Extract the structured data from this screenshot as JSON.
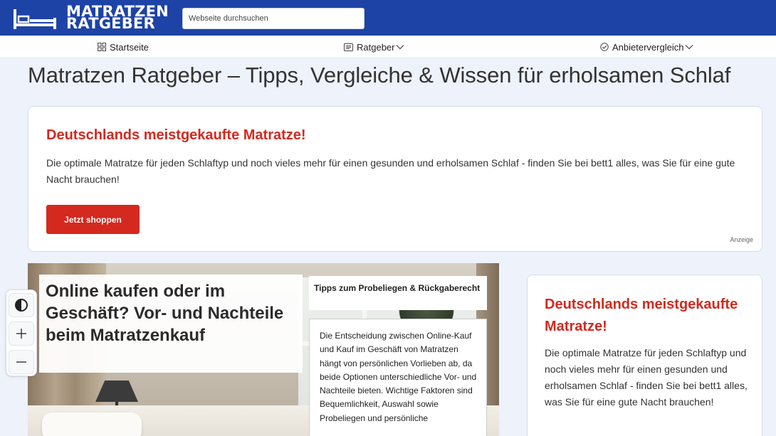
{
  "header": {
    "logo_line1": "MATRATZEN",
    "logo_line2": "RATGEBER",
    "search_placeholder": "Webseite durchsuchen"
  },
  "nav": {
    "items": [
      {
        "label": "Startseite",
        "icon": "grid-icon"
      },
      {
        "label": "Ratgeber",
        "icon": "document-icon"
      },
      {
        "label": "Anbietervergleich",
        "icon": "check-circle-icon"
      }
    ]
  },
  "page": {
    "title": "Matratzen Ratgeber – Tipps, Vergleiche & Wissen für erholsamen Schlaf"
  },
  "ad": {
    "title": "Deutschlands meistgekaufte Matratze!",
    "text": "Die optimale Matratze für jeden Schlaftyp und noch vieles mehr für einen gesunden und erholsamen Schlaf - finden Sie bei bett1 alles, was Sie für eine gute Nacht brauchen!",
    "button": "Jetzt shoppen",
    "label": "Anzeige"
  },
  "hero": {
    "title": "Online kaufen oder im Geschäft? Vor- und Nachteile beim Matratzenkauf",
    "tips_title": "Tipps zum Probeliegen & Rückgaberecht",
    "intro": "Die Entscheidung zwischen Online-Kauf und Kauf im Geschäft von Matratzen hängt von persönlichen Vorlieben ab, da beide Optionen unterschiedliche Vor- und Nachteile bieten. Wichtige Faktoren sind Bequemlichkeit, Auswahl sowie Probeliegen und persönliche"
  },
  "sidebar_ad": {
    "title": "Deutschlands meistgekaufte Matratze!",
    "text": "Die optimale Matratze für jeden Schlaftyp und noch vieles mehr für einen gesunden und erholsamen Schlaf - finden Sie bei bett1 alles, was Sie für eine gute Nacht brauchen!"
  },
  "accessibility": {
    "buttons": [
      "contrast-icon",
      "plus-icon",
      "minus-icon"
    ]
  },
  "colors": {
    "header_blue": "#1d43a7",
    "accent_red": "#d4291e",
    "page_bg": "#eef2fa"
  }
}
